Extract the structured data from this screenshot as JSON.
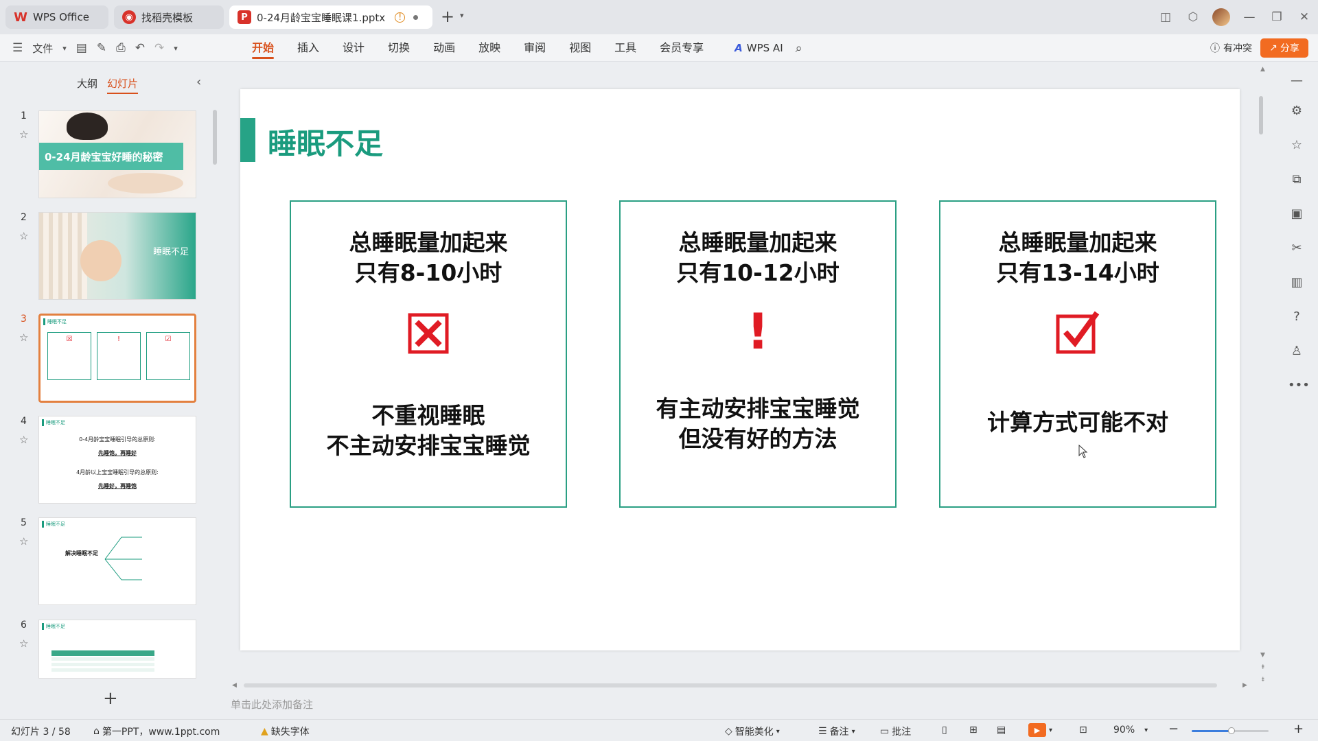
{
  "titlebar": {
    "tabs": [
      {
        "label": "WPS Office",
        "icon": "wps-logo-icon"
      },
      {
        "label": "找稻壳模板",
        "icon": "docer-icon"
      },
      {
        "label": "0-24月龄宝宝睡眠课1.pptx",
        "icon": "ppt-file-icon"
      }
    ],
    "new_tab": "+",
    "window_controls": [
      "layout-icon",
      "box-icon",
      "avatar",
      "minimize-icon",
      "restore-icon",
      "close-icon"
    ]
  },
  "toolbar": {
    "file_label": "文件",
    "menu_tabs": [
      "开始",
      "插入",
      "设计",
      "切换",
      "动画",
      "放映",
      "审阅",
      "视图",
      "工具",
      "会员专享"
    ],
    "active_tab": "开始",
    "wps_ai_label": "WPS AI",
    "conflict_label": "有冲突",
    "share_label": "分享",
    "accent_color": "#d8501c",
    "share_color": "#f26b21"
  },
  "panel": {
    "tab_outline": "大纲",
    "tab_slides": "幻灯片",
    "add_slide": "+",
    "thumbs": [
      {
        "num": "1",
        "title": "0-24月龄宝宝好睡的秘密"
      },
      {
        "num": "2",
        "title": "睡眠不足"
      },
      {
        "num": "3",
        "title": "睡眠不足"
      },
      {
        "num": "4",
        "title": "睡眠不足",
        "line1": "0-4月龄宝宝睡眠引导的总原则:",
        "line2": "先睡饱，再睡好",
        "line3": "4月龄以上宝宝睡眠引导的总原则:",
        "line4": "先睡好，再睡饱"
      },
      {
        "num": "5",
        "title": "睡眠不足",
        "center": "解决睡眠不足"
      },
      {
        "num": "6",
        "title": "睡眠不足"
      }
    ],
    "selected": "3"
  },
  "slide": {
    "title": "睡眠不足",
    "accent_color": "#1a9b7e",
    "cards": [
      {
        "head1": "总睡眠量加起来",
        "head2": "只有8-10小时",
        "mark": "x-box-icon",
        "foot1": "不重视睡眠",
        "foot2": "不主动安排宝宝睡觉"
      },
      {
        "head1": "总睡眠量加起来",
        "head2": "只有10-12小时",
        "mark": "exclamation-icon",
        "mark_text": "!",
        "foot1": "有主动安排宝宝睡觉",
        "foot2": "但没有好的方法"
      },
      {
        "head1": "总睡眠量加起来",
        "head2": "只有13-14小时",
        "mark": "check-box-icon",
        "foot1": "计算方式可能不对",
        "foot2": ""
      }
    ],
    "mark_color": "#e01b24"
  },
  "notes_placeholder": "单击此处添加备注",
  "statusbar": {
    "slide_counter": "幻灯片 3 / 58",
    "source": "第一PPT，www.1ppt.com",
    "missing_font": "缺失字体",
    "smart_beautify": "智能美化",
    "notes": "备注",
    "comments": "批注",
    "zoom": "90%"
  }
}
